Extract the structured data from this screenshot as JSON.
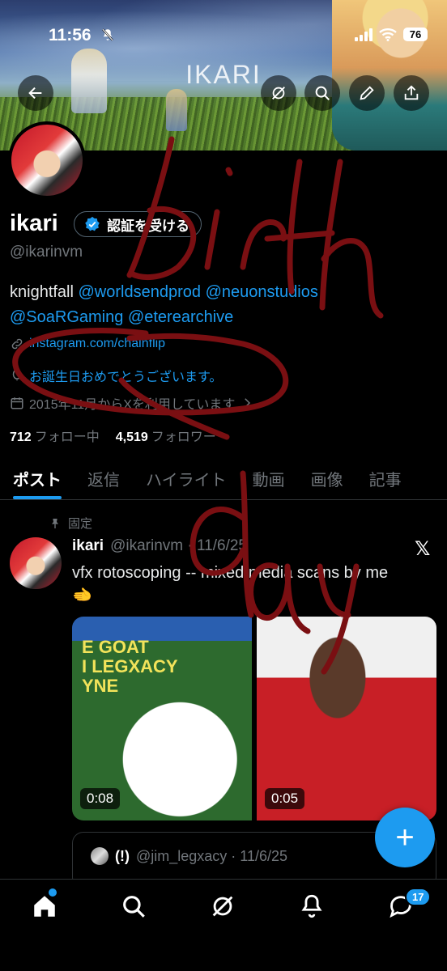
{
  "status": {
    "time": "11:56",
    "battery": "76"
  },
  "banner": {
    "title": "IKARI"
  },
  "profile": {
    "name": "ikari",
    "verify_label": "認証を受ける",
    "handle": "@ikarinvm",
    "bio_text": "knightfall",
    "bio_mentions": [
      "@worldsendprod",
      "@neuonstudios",
      "@SoaRGaming",
      "@eterearchive"
    ],
    "link": "instagram.com/chainflip",
    "birthday": "お誕生日おめでとうございます。",
    "joined": "2015年11月からXを利用しています",
    "following_count": "712",
    "following_label": "フォロー中",
    "followers_count": "4,519",
    "followers_label": "フォロワー"
  },
  "tabs": [
    {
      "label": "ポスト"
    },
    {
      "label": "返信"
    },
    {
      "label": "ハイライト"
    },
    {
      "label": "動画"
    },
    {
      "label": "画像"
    },
    {
      "label": "記事"
    }
  ],
  "tweet": {
    "pinned_label": "固定",
    "name": "ikari",
    "handle_date": "@ikarinvm · 11/6/25",
    "text": "vfx rotoscoping -- mixed media scans by me",
    "emoji": "🫲",
    "media1_text": "E GOAT\nI LEGXACY\nYNE",
    "media1_duration": "0:08",
    "media2_duration": "0:05",
    "quote_name": "(!)",
    "quote_handle_date": "@jim_legxacy · 11/6/25"
  },
  "fab": {
    "label": "+"
  },
  "nav": {
    "messages_badge": "17"
  },
  "overlay": {
    "handwriting": "birth day"
  },
  "colors": {
    "accent": "#1d9bf0",
    "background": "#000000",
    "scribble": "#7a0f12"
  }
}
